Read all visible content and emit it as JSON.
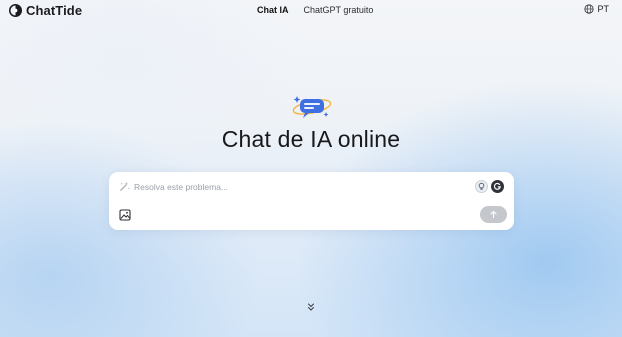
{
  "header": {
    "brand": "ChatTide",
    "nav": [
      {
        "label": "Chat IA",
        "active": true
      },
      {
        "label": "ChatGPT gratuito",
        "active": false
      }
    ],
    "language": "PT"
  },
  "hero": {
    "title": "Chat de IA online",
    "icon": "chat-bubble-orbit-icon"
  },
  "chat": {
    "placeholder": "Resolva este problema...",
    "value": "",
    "tools": [
      "lightbulb-icon",
      "grammarly-icon"
    ],
    "upload_icon": "image-upload-icon",
    "send_icon": "arrow-up-icon"
  },
  "footer": {
    "scroll_icon": "double-chevron-down-icon"
  },
  "colors": {
    "accent": "#3f6fe0",
    "send_disabled": "#c4c7cc",
    "text": "#17191d"
  }
}
